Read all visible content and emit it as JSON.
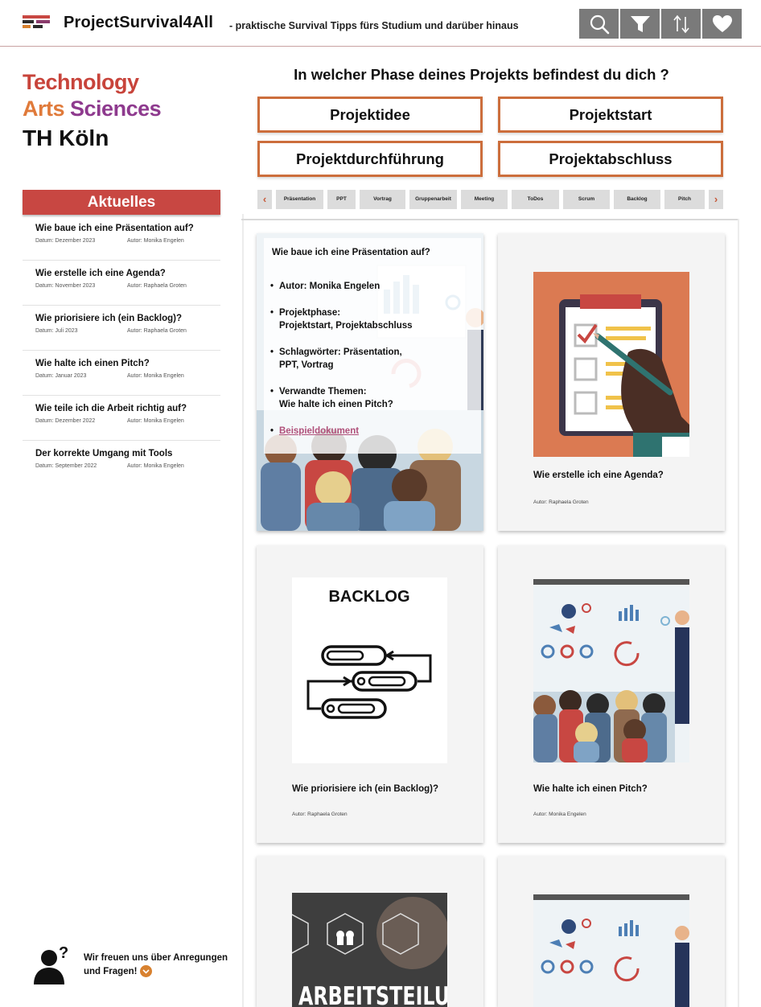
{
  "header": {
    "app_title": "ProjectSurvival4All",
    "tagline": "- praktische Survival Tipps fürs Studium und darüber hinaus",
    "buttons": [
      {
        "icon": "search-icon"
      },
      {
        "icon": "filter-icon"
      },
      {
        "icon": "sort-icon"
      },
      {
        "icon": "heart-icon"
      }
    ],
    "menu_colors": [
      "#c84742",
      "#8a3b6c",
      "#d8812f",
      "#2b2b2b"
    ]
  },
  "logo": {
    "line1": "Technology",
    "line2a": "Arts",
    "line2b": "Sciences",
    "line3": "TH Köln",
    "colors": {
      "technology": "#c8443b",
      "arts": "#e07a3a",
      "sciences": "#8e3a8e"
    }
  },
  "sidebar": {
    "title": "Aktuelles",
    "items": [
      {
        "title": "Wie baue ich eine Präsentation auf?",
        "date": "Datum: Dezember 2023",
        "author": "Autor: Monika Engelen"
      },
      {
        "title": "Wie erstelle ich eine Agenda?",
        "date": "Datum: November 2023",
        "author": "Autor: Raphaela Groten"
      },
      {
        "title": "Wie priorisiere ich (ein Backlog)?",
        "date": "Datum: Juli 2023",
        "author": "Autor: Raphaela Groten"
      },
      {
        "title": "Wie halte ich einen Pitch?",
        "date": "Datum: Januar 2023",
        "author": "Autor: Monika Engelen"
      },
      {
        "title": "Wie teile ich die Arbeit richtig auf?",
        "date": "Datum: Dezember 2022",
        "author": "Autor: Monika Engelen"
      },
      {
        "title": "Der korrekte Umgang mit Tools",
        "date": "Datum: September 2022",
        "author": "Autor: Monika Engelen"
      }
    ],
    "feedback": {
      "line1": "Wir freuen uns über Anregungen",
      "line2": "und Fragen!"
    }
  },
  "phases": {
    "question": "In welcher Phase deines Projekts befindest du dich ?",
    "buttons": [
      "Projektidee",
      "Projektstart",
      "Projektdurchführung",
      "Projektabschluss"
    ],
    "accent": "#cc6e3c"
  },
  "tags": {
    "prev": "‹",
    "next": "›",
    "items": [
      "Präsentation",
      "PPT",
      "Vortrag",
      "Gruppenarbeit",
      "Meeting",
      "ToDos",
      "Scrum",
      "Backlog",
      "Pitch"
    ]
  },
  "cards": {
    "featured": {
      "title": "Wie baue ich eine Präsentation auf?",
      "author": "Autor: Monika Engelen",
      "phase_label": "Projektphase:",
      "phase_value": "Projektstart, Projektabschluss",
      "keywords_label": "Schlagwörter: Präsentation,",
      "keywords_value": "PPT, Vortrag",
      "related_label": "Verwandte Themen:",
      "related_value": "Wie halte ich einen Pitch?",
      "link": "Beispieldokument"
    },
    "agenda": {
      "title": "Wie erstelle ich eine Agenda?",
      "author": "Autor: Raphaela Groten"
    },
    "backlog": {
      "title": "Wie priorisiere ich (ein Backlog)?",
      "author": "Autor: Raphaela Groten",
      "image_text": "BACKLOG"
    },
    "pitch": {
      "title": "Wie halte ich einen Pitch?",
      "author": "Autor: Monika Engelen"
    },
    "arbeitsteilung": {
      "image_text": "ARBEITSTEILU"
    }
  }
}
